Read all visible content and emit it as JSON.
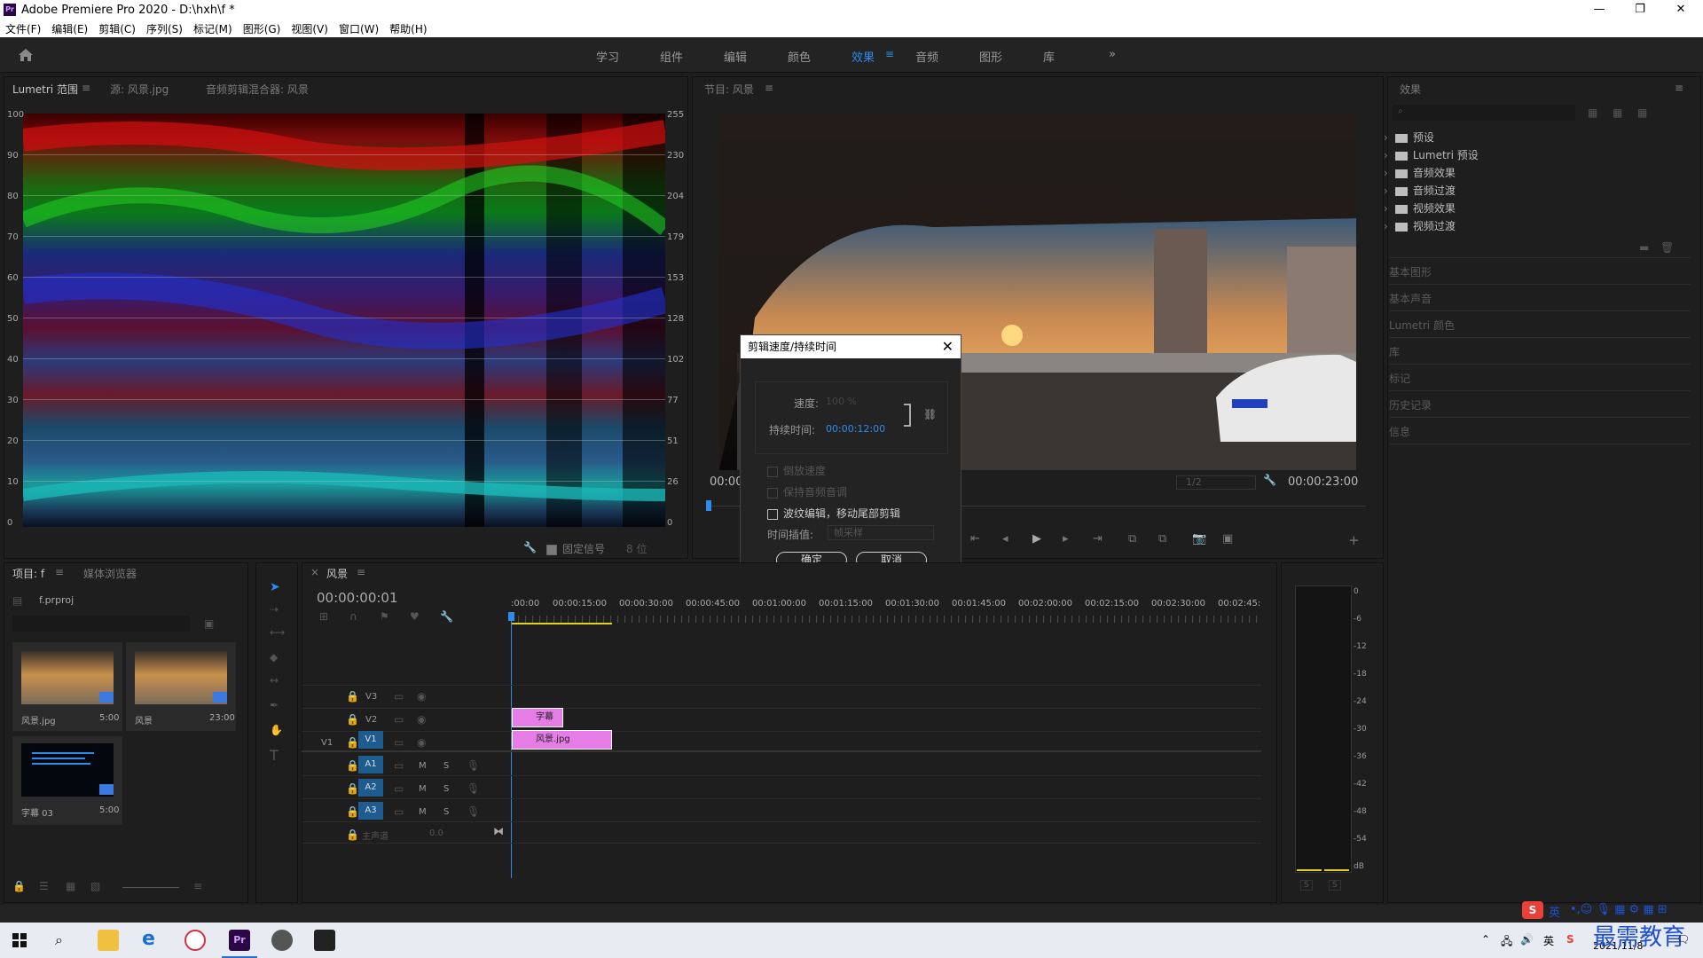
{
  "window": {
    "title": "Adobe Premiere Pro 2020 - D:\\hxh\\f *",
    "logo": "Pr",
    "controls": [
      "—",
      "❐",
      "✕"
    ]
  },
  "menu": [
    "文件(F)",
    "编辑(E)",
    "剪辑(C)",
    "序列(S)",
    "标记(M)",
    "图形(G)",
    "视图(V)",
    "窗口(W)",
    "帮助(H)"
  ],
  "workspaces": {
    "tabs": [
      "学习",
      "组件",
      "编辑",
      "颜色",
      "效果",
      "音频",
      "图形",
      "库"
    ],
    "active": "效果",
    "more": "»"
  },
  "source_panel": {
    "tabs": [
      "Lumetri 范围",
      "源: 风景.jpg",
      "音频剪辑混合器: 风景"
    ],
    "left_ticks": [
      "100",
      "90",
      "80",
      "70",
      "60",
      "50",
      "40",
      "30",
      "20",
      "10",
      "0"
    ],
    "right_ticks": [
      "255",
      "230",
      "204",
      "179",
      "153",
      "128",
      "102",
      "77",
      "51",
      "26",
      "0"
    ],
    "bottom_clamp_label": "固定信号",
    "bottom_bit_label": "8 位"
  },
  "program_panel": {
    "title": "节目: 风景",
    "timecode_left": "00:00",
    "timecode_right": "00:00:23:00",
    "zoom": "1/2"
  },
  "dialog": {
    "title": "剪辑速度/持续时间",
    "speed_label": "速度:",
    "speed_value": "100 %",
    "duration_label": "持续时间:",
    "duration_value": "00:00:12:00",
    "link_icon": "⛓",
    "reverse": "倒放速度",
    "maintain_pitch": "保持音频音调",
    "ripple": "波纹编辑，移动尾部剪辑",
    "interp_label": "时间插值:",
    "interp_value": "帧采样",
    "ok": "确定",
    "cancel": "取消"
  },
  "effects_panel": {
    "title": "效果",
    "items": [
      "预设",
      "Lumetri 预设",
      "音频效果",
      "音频过渡",
      "视频效果",
      "视频过渡"
    ],
    "sections": [
      "基本图形",
      "基本声音",
      "Lumetri 颜色",
      "库",
      "标记",
      "历史记录",
      "信息"
    ]
  },
  "project_panel": {
    "tabs": [
      "项目: f",
      "媒体浏览器"
    ],
    "file": "f.prproj",
    "items": [
      {
        "name": "风景.jpg",
        "dur": "5:00"
      },
      {
        "name": "风景",
        "dur": "23:00"
      },
      {
        "name": "字幕 03",
        "dur": "5:00"
      }
    ]
  },
  "timeline": {
    "tab": "风景",
    "close": "×",
    "timecode": "00:00:00:01",
    "ruler": [
      ":00:00",
      "00:00:15:00",
      "00:00:30:00",
      "00:00:45:00",
      "00:01:00:00",
      "00:01:15:00",
      "00:01:30:00",
      "00:01:45:00",
      "00:02:00:00",
      "00:02:15:00",
      "00:02:30:00",
      "00:02:45:"
    ],
    "video_tracks": [
      "V3",
      "V2",
      "V1"
    ],
    "audio_tracks": [
      "A1",
      "A2",
      "A3"
    ],
    "source_patch": "V1",
    "master": "主声道",
    "master_val": "0.0",
    "clip_title": "字幕",
    "clip_image": "风景.jpg",
    "m_label": "M",
    "s_label": "S"
  },
  "meter": {
    "ticks": [
      "0",
      "-6",
      "-12",
      "-18",
      "-24",
      "-30",
      "-36",
      "-42",
      "-48",
      "-54",
      "dB"
    ],
    "s_labels": [
      "S",
      "S"
    ]
  },
  "taskbar": {
    "date": "2021/11/8",
    "watermark": "最需教育",
    "ime": "英"
  },
  "colors": {
    "accent": "#2d8ceb",
    "track_button": "#1e5b8f",
    "clip_pink": "#e67de7",
    "bg": "#1d1d1d"
  }
}
